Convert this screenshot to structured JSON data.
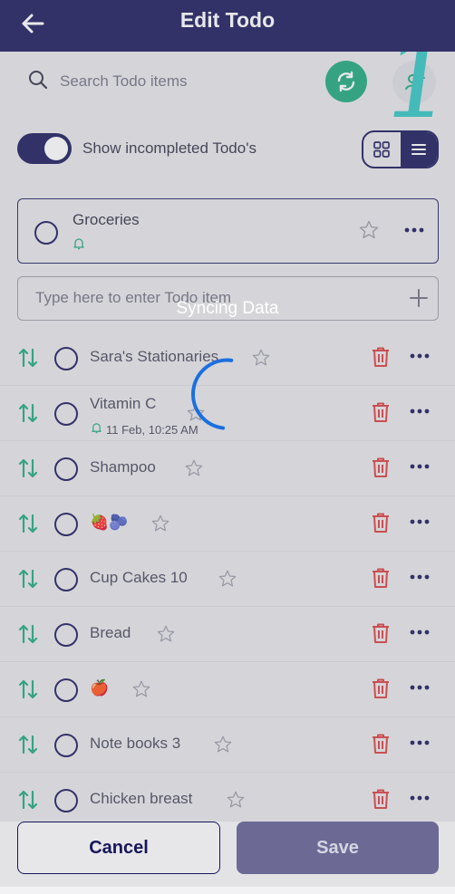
{
  "header": {
    "title": "Edit Todo"
  },
  "search": {
    "placeholder": "Search Todo items"
  },
  "annotation": "1",
  "toggle": {
    "label": "Show incompleted Todo's",
    "on": true
  },
  "parent_item": {
    "name": "Groceries"
  },
  "entry": {
    "placeholder": "Type here to enter Todo item"
  },
  "overlay": {
    "text": "Syncing Data"
  },
  "items": [
    {
      "label": "Sara's Stationaries"
    },
    {
      "label": "Vitamin C",
      "reminder": "11 Feb, 10:25 AM"
    },
    {
      "label": "Shampoo"
    },
    {
      "label": "🍓🫐"
    },
    {
      "label": "Cup Cakes 10"
    },
    {
      "label": "Bread"
    },
    {
      "label": "🍎"
    },
    {
      "label": "Note books 3"
    },
    {
      "label": "Chicken breast"
    }
  ],
  "footer": {
    "cancel_label": "Cancel",
    "save_label": "Save"
  },
  "colors": {
    "primary": "#17165a",
    "accent_green": "#1aa77a",
    "delete_red": "#d93b3b",
    "annotation": "#2ec4c1"
  }
}
